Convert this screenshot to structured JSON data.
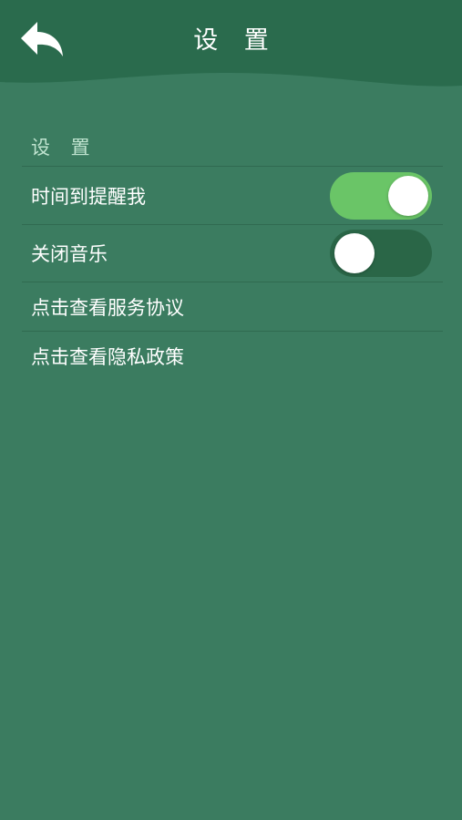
{
  "header": {
    "title": "设 置",
    "back_icon": "back-arrow-icon",
    "background_color": "#2a6b4d"
  },
  "section": {
    "title": "设 置"
  },
  "settings": {
    "remind": {
      "label": "时间到提醒我",
      "toggle_on": true
    },
    "music": {
      "label": "关闭音乐",
      "toggle_on": false
    },
    "service": {
      "label": "点击查看服务协议"
    },
    "privacy": {
      "label": "点击查看隐私政策"
    }
  },
  "colors": {
    "page_background": "#3b7c60",
    "toggle_on": "#6ac567",
    "toggle_off": "#2a6647",
    "section_text": "#bfe3cf"
  }
}
